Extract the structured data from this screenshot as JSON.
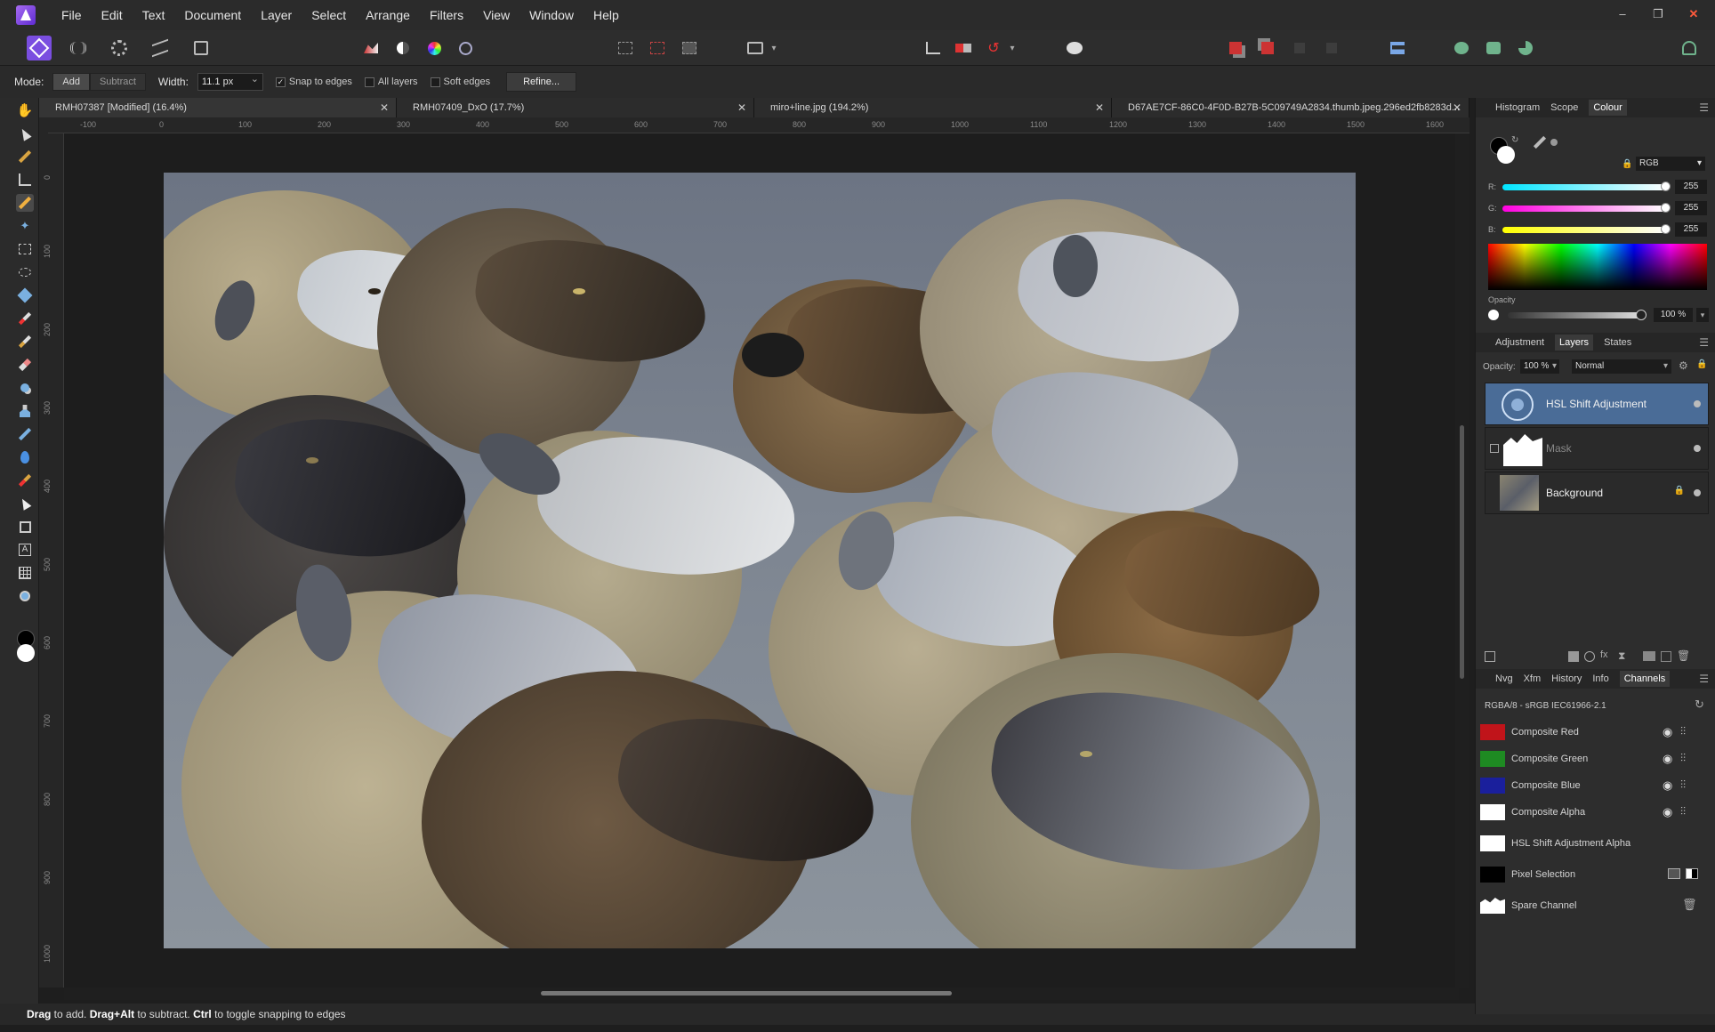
{
  "menu": [
    "File",
    "Edit",
    "Text",
    "Document",
    "Layer",
    "Select",
    "Arrange",
    "Filters",
    "View",
    "Window",
    "Help"
  ],
  "window_controls": [
    "–",
    "❐",
    "✕"
  ],
  "context": {
    "mode_label": "Mode:",
    "mode_add": "Add",
    "mode_subtract": "Subtract",
    "width_label": "Width:",
    "width_value": "11.1 px",
    "snap_to_edges": "Snap to edges",
    "all_layers": "All layers",
    "soft_edges": "Soft edges",
    "refine": "Refine..."
  },
  "tabs": [
    {
      "label": "RMH07387 [Modified] (16.4%)"
    },
    {
      "label": "RMH07409_DxO (17.7%)"
    },
    {
      "label": "miro+line.jpg (194.2%)"
    },
    {
      "label": "D67AE7CF-86C0-4F0D-B27B-5C09749A2834.thumb.jpeg.296ed2fb8283d..."
    }
  ],
  "tab_close": "✕",
  "ruler": {
    "unit": "px",
    "top_labels": [
      "-100",
      "0",
      "100",
      "200",
      "300",
      "400",
      "500",
      "600",
      "700",
      "800",
      "900",
      "1000",
      "1100",
      "1200",
      "1300",
      "1400",
      "1500",
      "1600"
    ],
    "left_labels": [
      "0",
      "100",
      "200",
      "300",
      "400",
      "500",
      "600",
      "700",
      "800",
      "900",
      "1000"
    ]
  },
  "status": {
    "k1": "Drag",
    "t1": " to add. ",
    "k2": "Drag+Alt",
    "t2": " to subtract. ",
    "k3": "Ctrl",
    "t3": " to toggle snapping to edges"
  },
  "colour_panel": {
    "tabs": [
      "Histogram",
      "Scope",
      "Colour"
    ],
    "active": "Colour",
    "model": "RGB",
    "r_label": "R:",
    "r": "255",
    "g_label": "G:",
    "g": "255",
    "b_label": "B:",
    "b": "255",
    "opacity_label": "Opacity",
    "opacity": "100 %"
  },
  "layers_panel": {
    "tabs": [
      "Adjustment",
      "Layers",
      "States"
    ],
    "active": "Layers",
    "opacity_label": "Opacity:",
    "opacity": "100 %",
    "blend": "Normal",
    "layers": [
      {
        "name": "HSL Shift Adjustment"
      },
      {
        "name": "Mask"
      },
      {
        "name": "Background"
      }
    ]
  },
  "channels_panel": {
    "tabs": [
      "Nvg",
      "Xfm",
      "History",
      "Info",
      "Channels"
    ],
    "active": "Channels",
    "profile": "RGBA/8 - sRGB IEC61966-2.1",
    "channels": [
      {
        "name": "Composite Red",
        "color": "#c0141a"
      },
      {
        "name": "Composite Green",
        "color": "#1e8a22"
      },
      {
        "name": "Composite Blue",
        "color": "#1a1f9c"
      },
      {
        "name": "Composite Alpha",
        "color": "#ffffff"
      },
      {
        "name": "HSL Shift Adjustment Alpha",
        "color": "#ffffff"
      },
      {
        "name": "Pixel Selection",
        "color": "#000000"
      },
      {
        "name": "Spare Channel",
        "color": "#ffffff"
      }
    ]
  },
  "colors": {
    "accent": "#7a4ee0",
    "selection": "#4a6c97"
  }
}
